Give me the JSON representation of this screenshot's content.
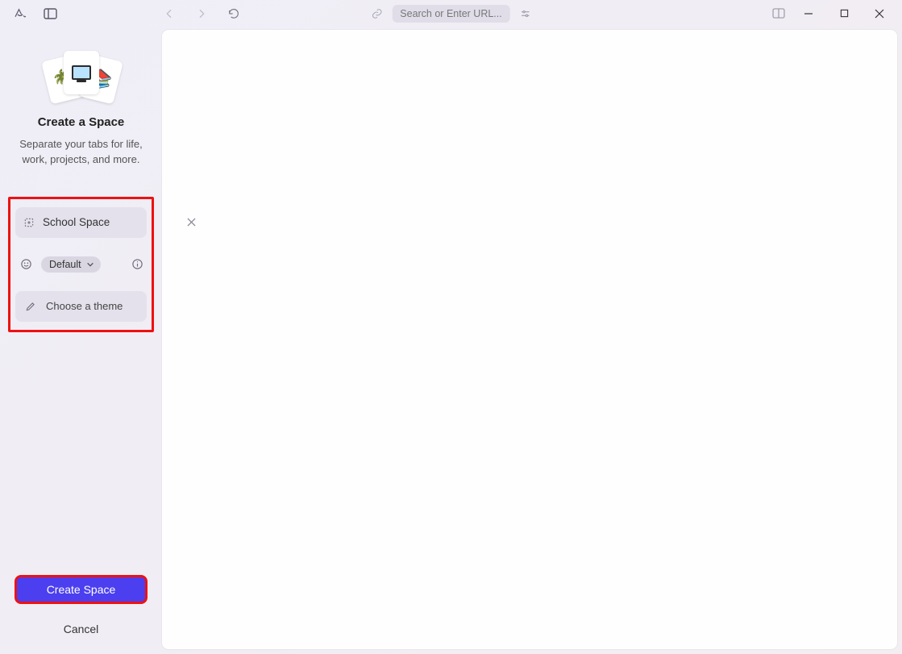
{
  "toolbar": {
    "url_placeholder": "Search or Enter URL..."
  },
  "sidebar": {
    "title": "Create a Space",
    "subtitle": "Separate your tabs for life, work, projects, and more.",
    "space_name_value": "School Space",
    "profile_label": "Default",
    "theme_label": "Choose a theme"
  },
  "actions": {
    "create_label": "Create Space",
    "cancel_label": "Cancel"
  }
}
